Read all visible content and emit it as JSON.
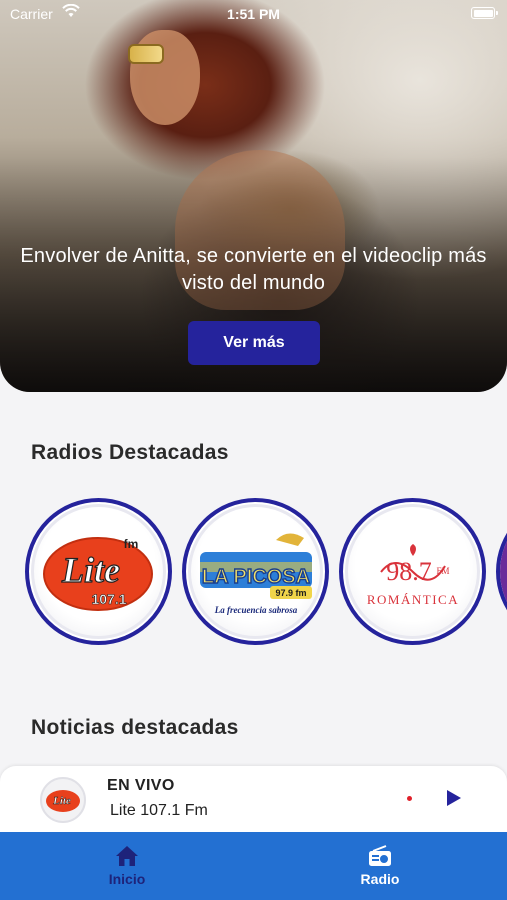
{
  "status_bar": {
    "carrier": "Carrier",
    "time": "1:51 PM"
  },
  "hero": {
    "title": "Envolver de Anitta, se convierte en el videoclip más visto del mundo",
    "button_label": "Ver más"
  },
  "radios_section": {
    "title": "Radios Destacadas",
    "stations": [
      {
        "logo_text": "Lite",
        "frequency": "107.1",
        "band": "fm"
      },
      {
        "logo_text": "LA PICOSA",
        "frequency": "97.9 fm",
        "slogan": "La frecuencia sabrosa"
      },
      {
        "logo_text": "ROMÁNTICA",
        "frequency": "98.7",
        "band": "FM"
      }
    ]
  },
  "news_section": {
    "title": "Noticias destacadas"
  },
  "player": {
    "status": "EN VIVO",
    "station": "Lite 107.1 Fm"
  },
  "tabs": [
    {
      "label": "Inicio",
      "icon": "home-icon",
      "active": true
    },
    {
      "label": "Radio",
      "icon": "radio-icon",
      "active": false
    }
  ],
  "colors": {
    "accent": "#25239c",
    "tabbar": "#2370d2",
    "background": "#f4f4f6"
  }
}
